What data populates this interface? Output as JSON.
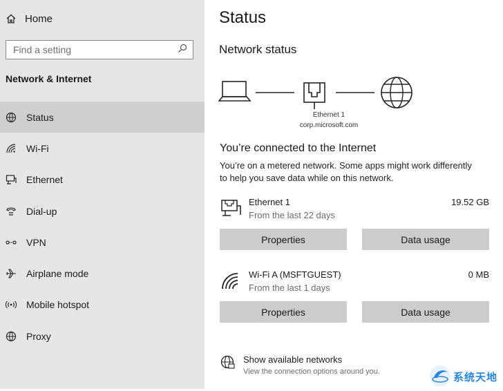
{
  "sidebar": {
    "home_label": "Home",
    "search_placeholder": "Find a setting",
    "section_title": "Network & Internet",
    "items": [
      {
        "label": "Status",
        "icon": "status-globe-icon"
      },
      {
        "label": "Wi-Fi",
        "icon": "wifi-icon"
      },
      {
        "label": "Ethernet",
        "icon": "ethernet-icon"
      },
      {
        "label": "Dial-up",
        "icon": "dialup-icon"
      },
      {
        "label": "VPN",
        "icon": "vpn-icon"
      },
      {
        "label": "Airplane mode",
        "icon": "airplane-icon"
      },
      {
        "label": "Mobile hotspot",
        "icon": "hotspot-icon"
      },
      {
        "label": "Proxy",
        "icon": "globe-icon"
      }
    ],
    "active_index": 0
  },
  "main": {
    "title": "Status",
    "subtitle": "Network status",
    "diagram": {
      "adapter_name": "Ethernet 1",
      "domain": "corp.microsoft.com"
    },
    "connected_heading": "You’re connected to the Internet",
    "connected_desc": "You’re on a metered network. Some apps might work differently to help you save data while on this network.",
    "networks": [
      {
        "name": "Ethernet 1",
        "period": "From the last 22 days",
        "usage": "19.52 GB",
        "icon": "ethernet-icon",
        "properties_label": "Properties",
        "data_usage_label": "Data usage"
      },
      {
        "name": "Wi-Fi A (MSFTGUEST)",
        "period": "From the last 1 days",
        "usage": "0 MB",
        "icon": "wifi-icon",
        "properties_label": "Properties",
        "data_usage_label": "Data usage"
      }
    ],
    "show_networks": {
      "title": "Show available networks",
      "desc": "View the connection options around you."
    }
  },
  "watermark": {
    "text": "系统天地",
    "color": "#2a86d8"
  }
}
